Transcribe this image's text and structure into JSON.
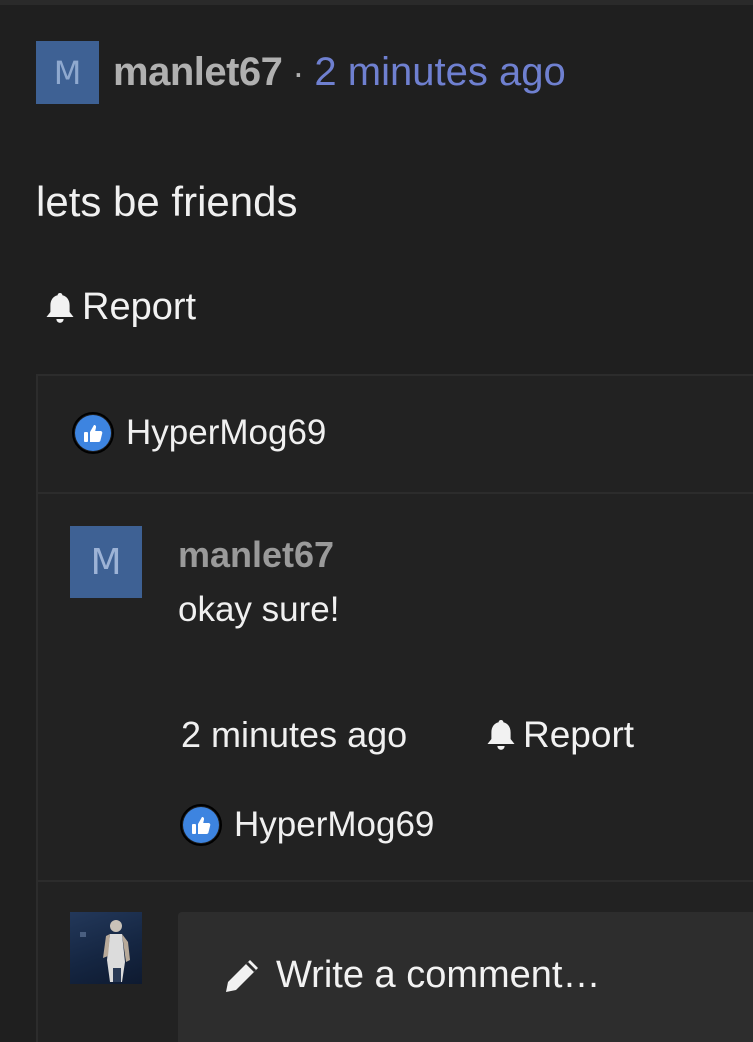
{
  "post": {
    "avatar_letter": "M",
    "author": "manlet67",
    "separator": "·",
    "time": "2 minutes ago",
    "body": "lets be friends",
    "report_label": "Report"
  },
  "likes": {
    "post_liker": "HyperMog69"
  },
  "comment": {
    "avatar_letter": "M",
    "author": "manlet67",
    "text": "okay sure!",
    "time": "2 minutes ago",
    "report_label": "Report",
    "liker": "HyperMog69"
  },
  "composer": {
    "placeholder": "Write a comment…"
  },
  "colors": {
    "background": "#1f1f1f",
    "avatar": "#3e6194",
    "timestamp_link": "#6f80d0",
    "like_badge": "#3d84e0",
    "composer": "#2d2d2d"
  },
  "icons": [
    "bell-icon",
    "thumbs-up-icon",
    "pencil-icon"
  ]
}
